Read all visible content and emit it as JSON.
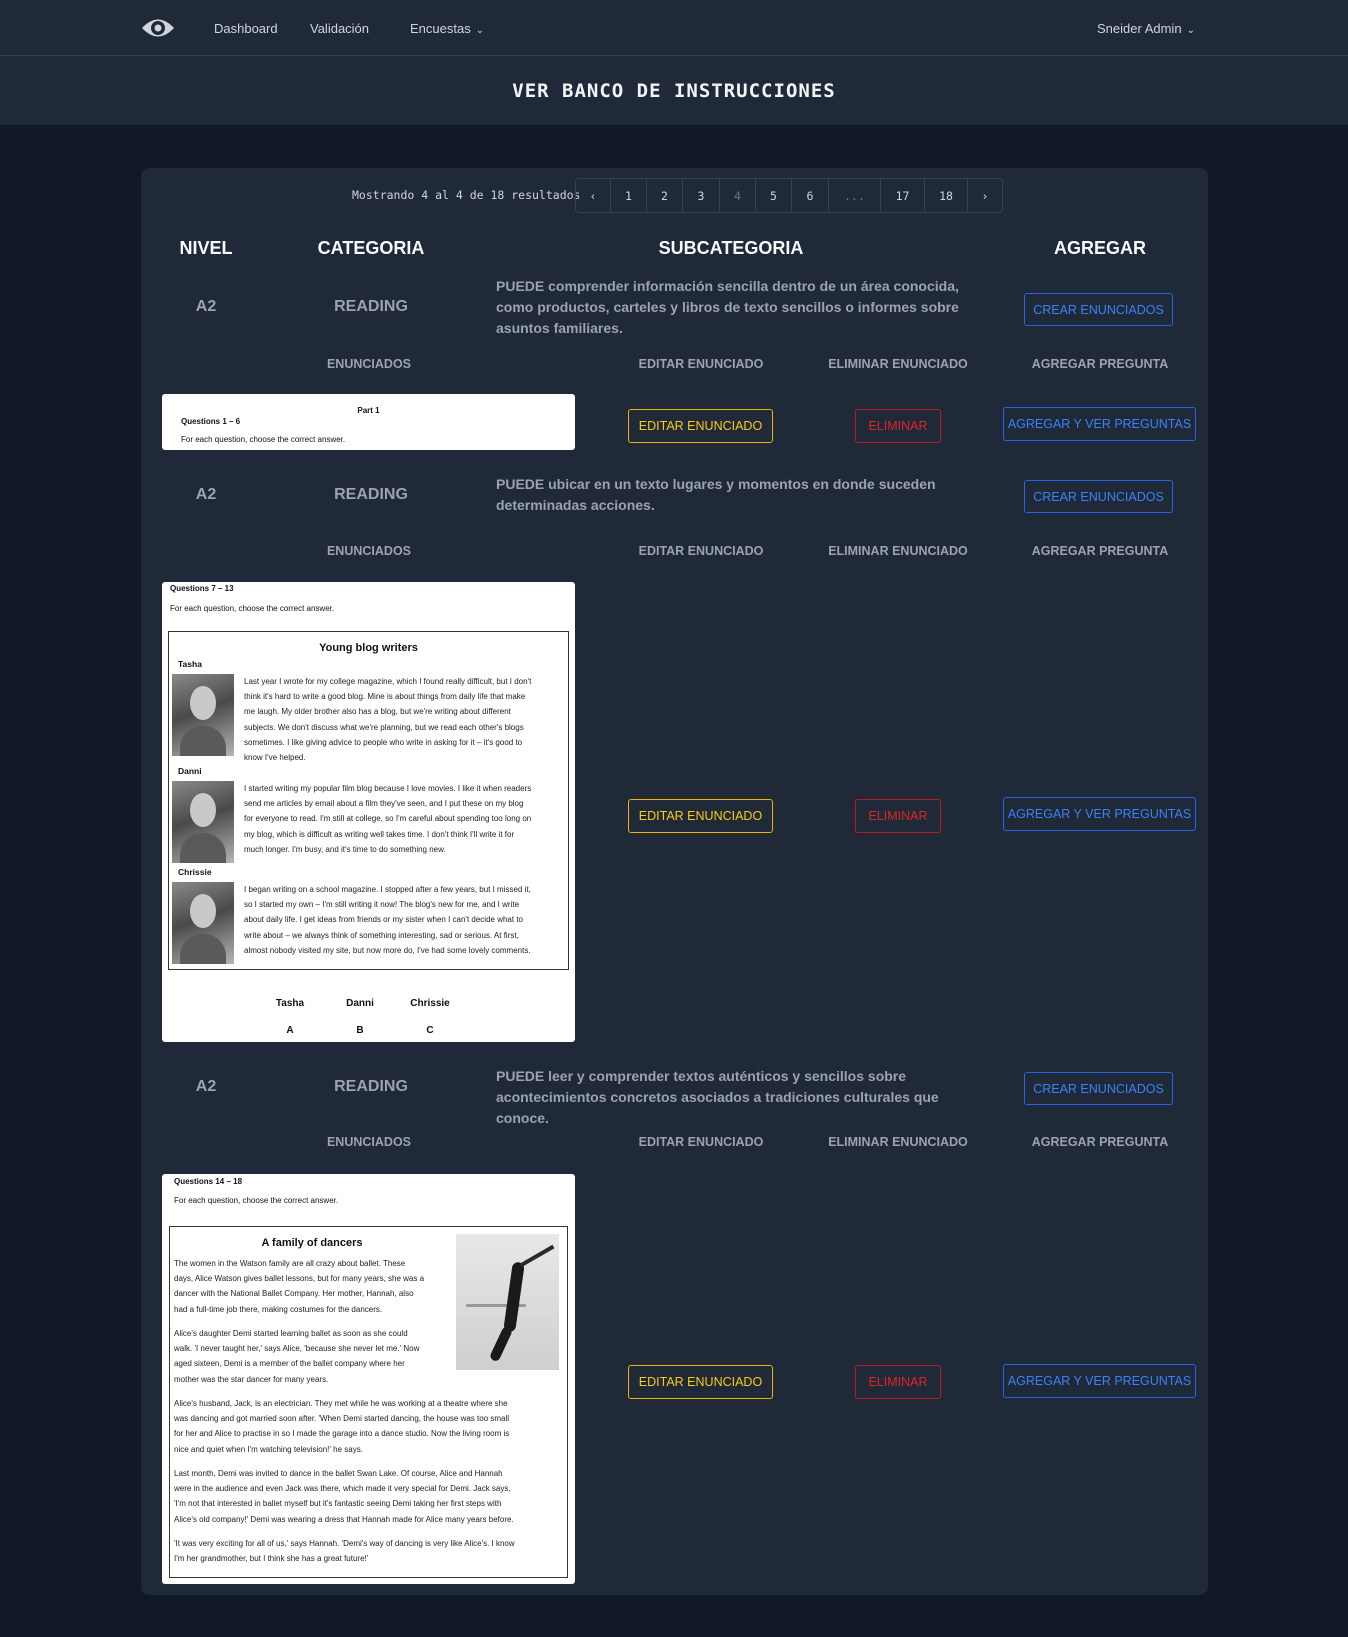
{
  "nav": {
    "links": [
      "Dashboard",
      "Validación",
      "Encuestas"
    ],
    "user": "Sneider Admin"
  },
  "header": {
    "title": "VER BANCO DE INSTRUCCIONES"
  },
  "pagination": {
    "results": "Mostrando 4 al 4 de 18 resultados",
    "pages": [
      "‹",
      "1",
      "2",
      "3",
      "4",
      "5",
      "6",
      "...",
      "17",
      "18",
      "›"
    ],
    "current": "4"
  },
  "columns": {
    "nivel": "NIVEL",
    "categoria": "CATEGORIA",
    "subcategoria": "SUBCATEGORIA",
    "agregar": "AGREGAR"
  },
  "subheaders": {
    "enunciados": "ENUNCIADOS",
    "editar": "EDITAR ENUNCIADO",
    "eliminar": "ELIMINAR ENUNCIADO",
    "agregar": "AGREGAR PREGUNTA"
  },
  "buttons": {
    "crear": "CREAR ENUNCIADOS",
    "editar": "EDITAR ENUNCIADO",
    "eliminar": "ELIMINAR",
    "agregar": "AGREGAR Y VER PREGUNTAS"
  },
  "groups": [
    {
      "level": "A2",
      "category": "READING",
      "subcategory": "PUEDE comprender información sencilla dentro de un área conocida, como productos, carteles y libros de texto sencillos o informes sobre asuntos familiares.",
      "doc": {
        "part": "Part 1",
        "questions": "Questions 1 – 6",
        "instruction": "For each question, choose the correct answer."
      }
    },
    {
      "level": "A2",
      "category": "READING",
      "subcategory": "PUEDE ubicar en un texto lugares y momentos en donde suceden determinadas acciones.",
      "doc": {
        "questions": "Questions 7 – 13",
        "instruction": "For each question, choose the correct answer.",
        "title": "Young blog writers",
        "people": [
          {
            "name": "Tasha",
            "lines": [
              "Last year I wrote for my college magazine, which I found really difficult, but I don't",
              "think it's hard to write a good blog. Mine is about things from daily life that make",
              "me laugh. My older brother also has a blog, but we're writing about different",
              "subjects. We don't discuss what we're planning, but we read each other's blogs",
              "sometimes. I like giving advice to people who write in asking for it – it's good to",
              "know I've helped."
            ]
          },
          {
            "name": "Danni",
            "lines": [
              "I started writing my popular film blog because I love movies. I like it when readers",
              "send me articles by email about a film they've seen, and I put these on my blog",
              "for everyone to read. I'm still at college, so I'm careful about spending too long on",
              "my blog, which is difficult as writing well takes time. I don't think I'll write it for",
              "much longer. I'm busy, and it's time to do something new."
            ]
          },
          {
            "name": "Chrissie",
            "lines": [
              "I began writing on a school magazine. I stopped after a few years, but I missed it,",
              "so I started my own – I'm still writing it now! The blog's new for me, and I write",
              "about daily life. I get ideas from friends or my sister when I can't decide what to",
              "write about – we always think of something interesting, sad or serious. At first,",
              "almost nobody visited my site, but now more do, I've had some lovely comments."
            ]
          }
        ],
        "options": [
          [
            "Tasha",
            "A"
          ],
          [
            "Danni",
            "B"
          ],
          [
            "Chrissie",
            "C"
          ]
        ]
      }
    },
    {
      "level": "A2",
      "category": "READING",
      "subcategory": "PUEDE leer y comprender textos auténticos y sencillos sobre acontecimientos concretos asociados a tradiciones culturales que conoce.",
      "doc": {
        "questions": "Questions 14 – 18",
        "instruction": "For each question, choose the correct answer.",
        "title": "A family of dancers",
        "para1": [
          "The women in the Watson family are all crazy about ballet. These",
          "days, Alice Watson gives ballet lessons, but for many years, she was a",
          "dancer with the National Ballet Company. Her mother, Hannah, also",
          "had a full-time job there, making costumes for the dancers."
        ],
        "para2": [
          "Alice's daughter Demi started learning ballet as soon as she could",
          "walk. 'I never taught her,' says Alice, 'because she never let me.' Now",
          "aged sixteen, Demi is a member of the ballet company where her",
          "mother was the star dancer for many years."
        ],
        "para3": [
          "Alice's husband, Jack, is an electrician. They met while he was working at a theatre where she",
          "was dancing and got married soon after. 'When Demi started dancing, the house was too small",
          "for her and Alice to practise in so I made the garage into a dance studio. Now the living room is",
          "nice and quiet when I'm watching television!' he says."
        ],
        "para4": [
          "Last month, Demi was invited to dance in the ballet Swan Lake. Of course, Alice and Hannah",
          "were in the audience and even Jack was there, which made it very special for Demi. Jack says,",
          "'I'm not that interested in ballet myself but it's fantastic seeing Demi taking her first steps with",
          "Alice's old company!' Demi was wearing a dress that Hannah made for Alice many years before."
        ],
        "para5": [
          "'It was very exciting for all of us,' says Hannah. 'Demi's way of dancing is very like Alice's. I know",
          "I'm her grandmother, but I think she has a great future!'"
        ]
      }
    }
  ]
}
